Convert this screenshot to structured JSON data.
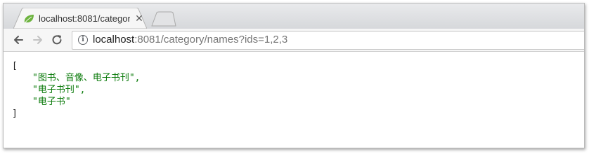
{
  "tab": {
    "title": "localhost:8081/categor",
    "favicon": "spring-leaf-icon",
    "close_glyph": "✕"
  },
  "toolbar": {
    "back": "back-arrow-icon",
    "forward": "forward-arrow-icon",
    "reload": "reload-icon"
  },
  "address": {
    "host": "localhost",
    "rest": ":8081/category/names?ids=1,2,3"
  },
  "json_view": {
    "open": "[",
    "items": [
      "\"图书、音像、电子书刊\",",
      "\"电子书刊\",",
      "\"电子书\""
    ],
    "close": "]"
  },
  "colors": {
    "string": "#0a7a0a",
    "favicon": "#6db33f"
  }
}
